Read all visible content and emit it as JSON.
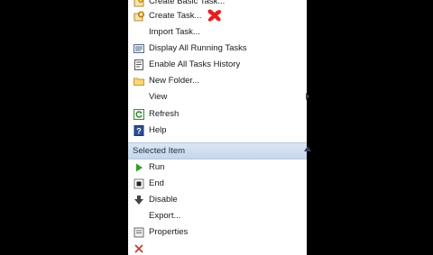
{
  "menu": {
    "items_top": [
      {
        "label": "Create Basic Task...",
        "icon": "create-basic-task-icon"
      },
      {
        "label": "Create Task...",
        "icon": "create-task-icon"
      },
      {
        "label": "Import Task...",
        "icon": "none"
      },
      {
        "label": "Display All Running Tasks",
        "icon": "running-tasks-icon"
      },
      {
        "label": "Enable All Tasks History",
        "icon": "history-icon"
      },
      {
        "label": "New Folder...",
        "icon": "folder-icon"
      },
      {
        "label": "View",
        "icon": "none"
      },
      {
        "label": "Refresh",
        "icon": "refresh-icon"
      },
      {
        "label": "Help",
        "icon": "help-icon"
      }
    ],
    "section_title": "Selected Item",
    "items_bottom": [
      {
        "label": "Run",
        "icon": "play-icon"
      },
      {
        "label": "End",
        "icon": "stop-icon"
      },
      {
        "label": "Disable",
        "icon": "disable-icon"
      },
      {
        "label": "Export...",
        "icon": "none"
      },
      {
        "label": "Properties",
        "icon": "properties-icon"
      }
    ]
  },
  "colors": {
    "background": "#000000",
    "panel": "#ffffff",
    "section_header": "#c6d6ea",
    "play_green": "#2e9b2e",
    "annotation_red": "#e81c1c"
  }
}
